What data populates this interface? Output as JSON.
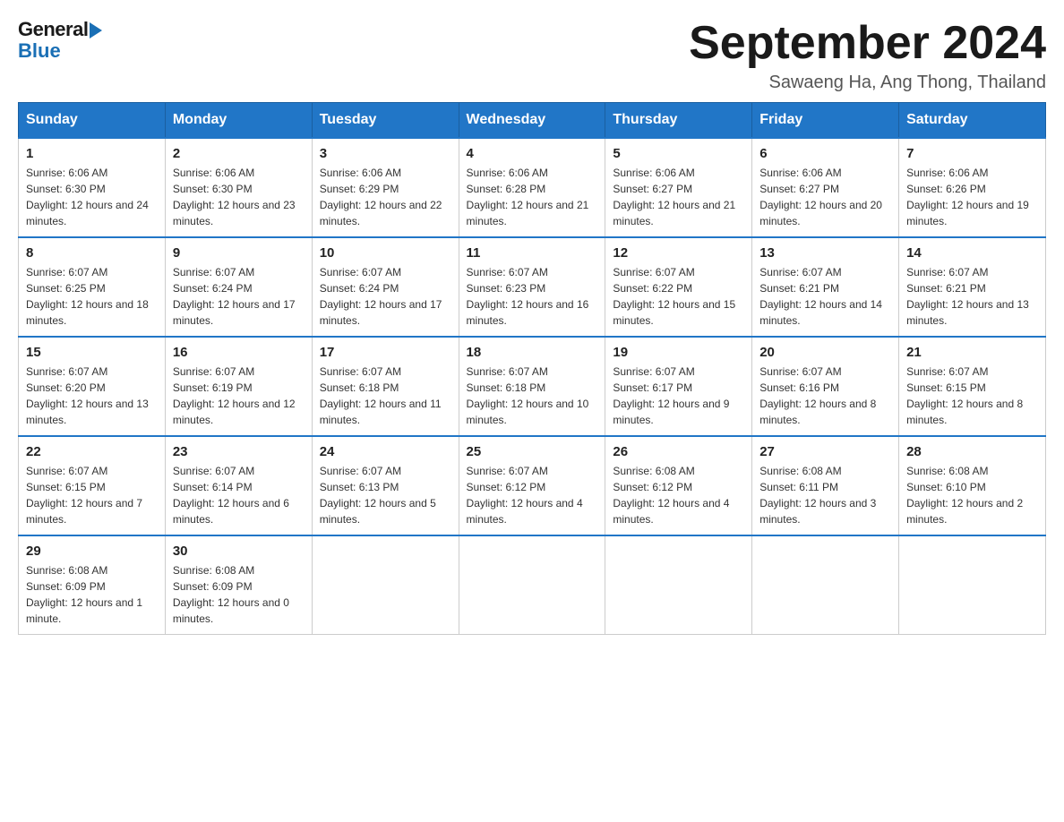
{
  "header": {
    "logo": {
      "general": "General",
      "blue": "Blue"
    },
    "title": "September 2024",
    "location": "Sawaeng Ha, Ang Thong, Thailand"
  },
  "calendar": {
    "weekdays": [
      "Sunday",
      "Monday",
      "Tuesday",
      "Wednesday",
      "Thursday",
      "Friday",
      "Saturday"
    ],
    "weeks": [
      [
        {
          "day": "1",
          "sunrise": "6:06 AM",
          "sunset": "6:30 PM",
          "daylight": "12 hours and 24 minutes."
        },
        {
          "day": "2",
          "sunrise": "6:06 AM",
          "sunset": "6:30 PM",
          "daylight": "12 hours and 23 minutes."
        },
        {
          "day": "3",
          "sunrise": "6:06 AM",
          "sunset": "6:29 PM",
          "daylight": "12 hours and 22 minutes."
        },
        {
          "day": "4",
          "sunrise": "6:06 AM",
          "sunset": "6:28 PM",
          "daylight": "12 hours and 21 minutes."
        },
        {
          "day": "5",
          "sunrise": "6:06 AM",
          "sunset": "6:27 PM",
          "daylight": "12 hours and 21 minutes."
        },
        {
          "day": "6",
          "sunrise": "6:06 AM",
          "sunset": "6:27 PM",
          "daylight": "12 hours and 20 minutes."
        },
        {
          "day": "7",
          "sunrise": "6:06 AM",
          "sunset": "6:26 PM",
          "daylight": "12 hours and 19 minutes."
        }
      ],
      [
        {
          "day": "8",
          "sunrise": "6:07 AM",
          "sunset": "6:25 PM",
          "daylight": "12 hours and 18 minutes."
        },
        {
          "day": "9",
          "sunrise": "6:07 AM",
          "sunset": "6:24 PM",
          "daylight": "12 hours and 17 minutes."
        },
        {
          "day": "10",
          "sunrise": "6:07 AM",
          "sunset": "6:24 PM",
          "daylight": "12 hours and 17 minutes."
        },
        {
          "day": "11",
          "sunrise": "6:07 AM",
          "sunset": "6:23 PM",
          "daylight": "12 hours and 16 minutes."
        },
        {
          "day": "12",
          "sunrise": "6:07 AM",
          "sunset": "6:22 PM",
          "daylight": "12 hours and 15 minutes."
        },
        {
          "day": "13",
          "sunrise": "6:07 AM",
          "sunset": "6:21 PM",
          "daylight": "12 hours and 14 minutes."
        },
        {
          "day": "14",
          "sunrise": "6:07 AM",
          "sunset": "6:21 PM",
          "daylight": "12 hours and 13 minutes."
        }
      ],
      [
        {
          "day": "15",
          "sunrise": "6:07 AM",
          "sunset": "6:20 PM",
          "daylight": "12 hours and 13 minutes."
        },
        {
          "day": "16",
          "sunrise": "6:07 AM",
          "sunset": "6:19 PM",
          "daylight": "12 hours and 12 minutes."
        },
        {
          "day": "17",
          "sunrise": "6:07 AM",
          "sunset": "6:18 PM",
          "daylight": "12 hours and 11 minutes."
        },
        {
          "day": "18",
          "sunrise": "6:07 AM",
          "sunset": "6:18 PM",
          "daylight": "12 hours and 10 minutes."
        },
        {
          "day": "19",
          "sunrise": "6:07 AM",
          "sunset": "6:17 PM",
          "daylight": "12 hours and 9 minutes."
        },
        {
          "day": "20",
          "sunrise": "6:07 AM",
          "sunset": "6:16 PM",
          "daylight": "12 hours and 8 minutes."
        },
        {
          "day": "21",
          "sunrise": "6:07 AM",
          "sunset": "6:15 PM",
          "daylight": "12 hours and 8 minutes."
        }
      ],
      [
        {
          "day": "22",
          "sunrise": "6:07 AM",
          "sunset": "6:15 PM",
          "daylight": "12 hours and 7 minutes."
        },
        {
          "day": "23",
          "sunrise": "6:07 AM",
          "sunset": "6:14 PM",
          "daylight": "12 hours and 6 minutes."
        },
        {
          "day": "24",
          "sunrise": "6:07 AM",
          "sunset": "6:13 PM",
          "daylight": "12 hours and 5 minutes."
        },
        {
          "day": "25",
          "sunrise": "6:07 AM",
          "sunset": "6:12 PM",
          "daylight": "12 hours and 4 minutes."
        },
        {
          "day": "26",
          "sunrise": "6:08 AM",
          "sunset": "6:12 PM",
          "daylight": "12 hours and 4 minutes."
        },
        {
          "day": "27",
          "sunrise": "6:08 AM",
          "sunset": "6:11 PM",
          "daylight": "12 hours and 3 minutes."
        },
        {
          "day": "28",
          "sunrise": "6:08 AM",
          "sunset": "6:10 PM",
          "daylight": "12 hours and 2 minutes."
        }
      ],
      [
        {
          "day": "29",
          "sunrise": "6:08 AM",
          "sunset": "6:09 PM",
          "daylight": "12 hours and 1 minute."
        },
        {
          "day": "30",
          "sunrise": "6:08 AM",
          "sunset": "6:09 PM",
          "daylight": "12 hours and 0 minutes."
        },
        null,
        null,
        null,
        null,
        null
      ]
    ]
  }
}
